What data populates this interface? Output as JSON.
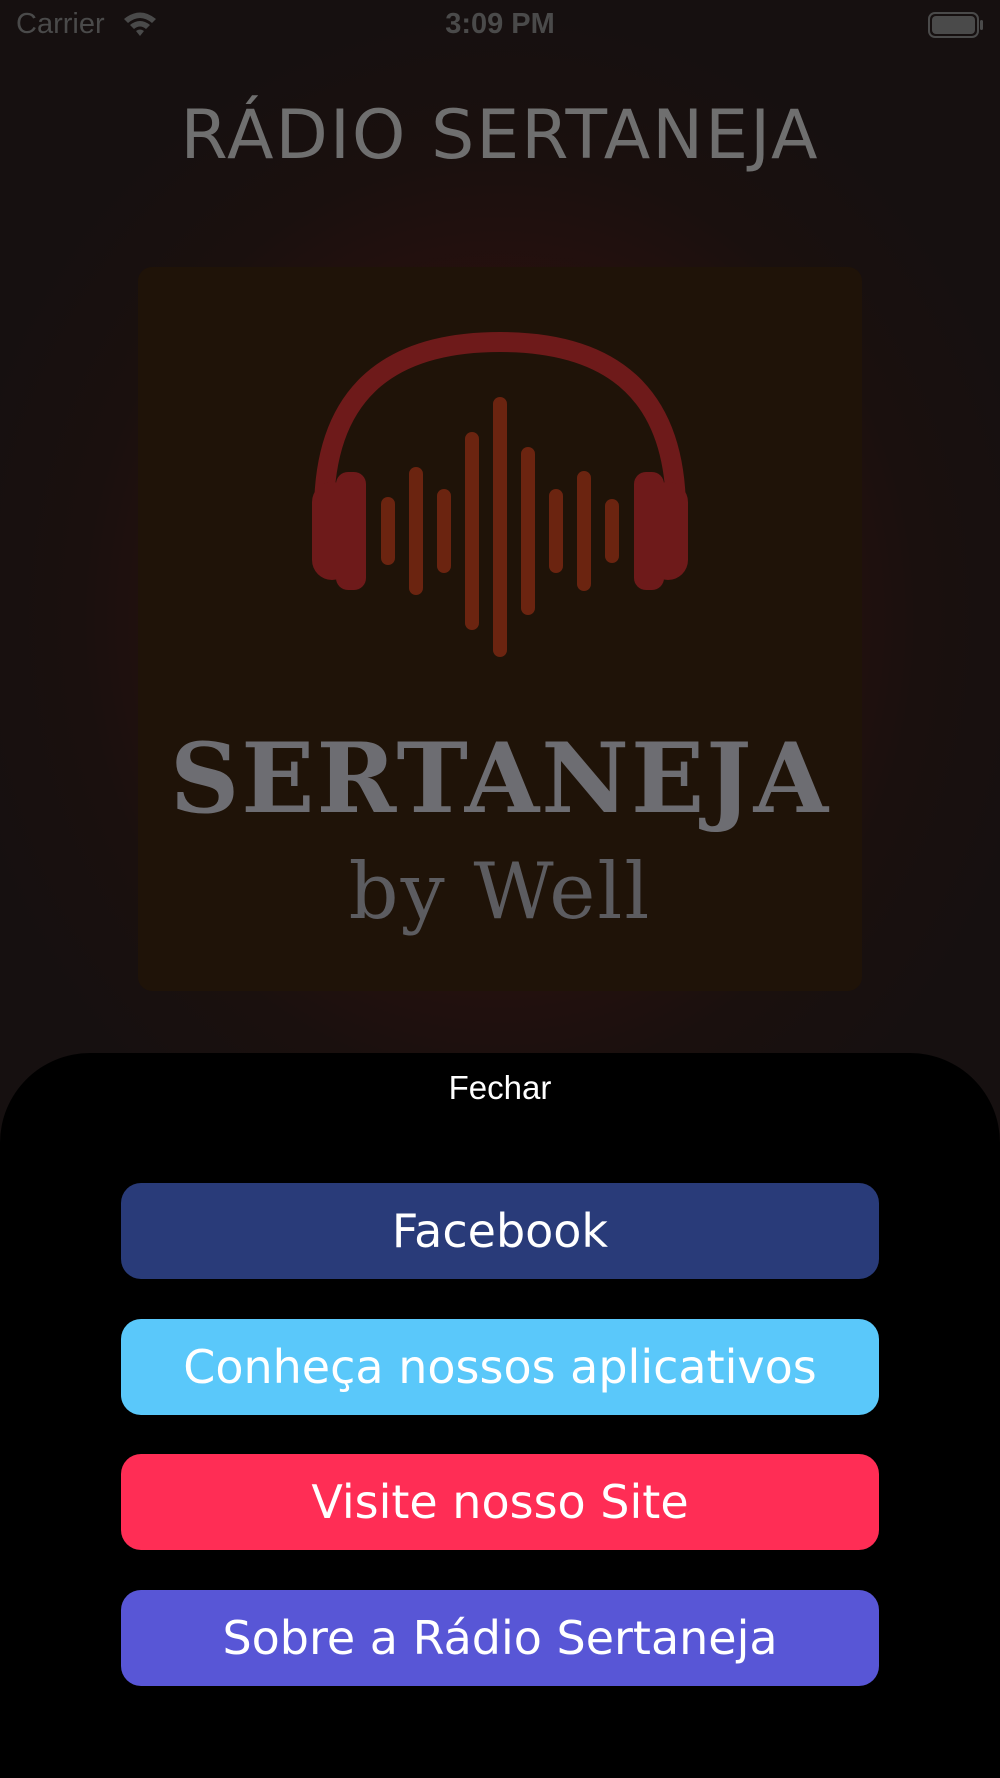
{
  "status_bar": {
    "carrier": "Carrier",
    "time": "3:09 PM"
  },
  "app": {
    "title": "RÁDIO SERTANEJA"
  },
  "logo": {
    "icon": "headphones-sound-wave-icon",
    "headline": "SERTANEJA",
    "byline": "by Well"
  },
  "sheet": {
    "close_label": "Fechar",
    "buttons": [
      {
        "label": "Facebook",
        "color": "#293b79"
      },
      {
        "label": "Conheça nossos aplicativos",
        "color": "#5ac8fa"
      },
      {
        "label": "Visite nosso Site",
        "color": "#ff2d55"
      },
      {
        "label": "Sobre a Rádio Sertaneja",
        "color": "#5856d6"
      }
    ]
  },
  "colors": {
    "background": "#170f0d",
    "sheet_background": "#000000",
    "logo_red": "#6e1a1a",
    "logo_orange": "#6b2410"
  }
}
